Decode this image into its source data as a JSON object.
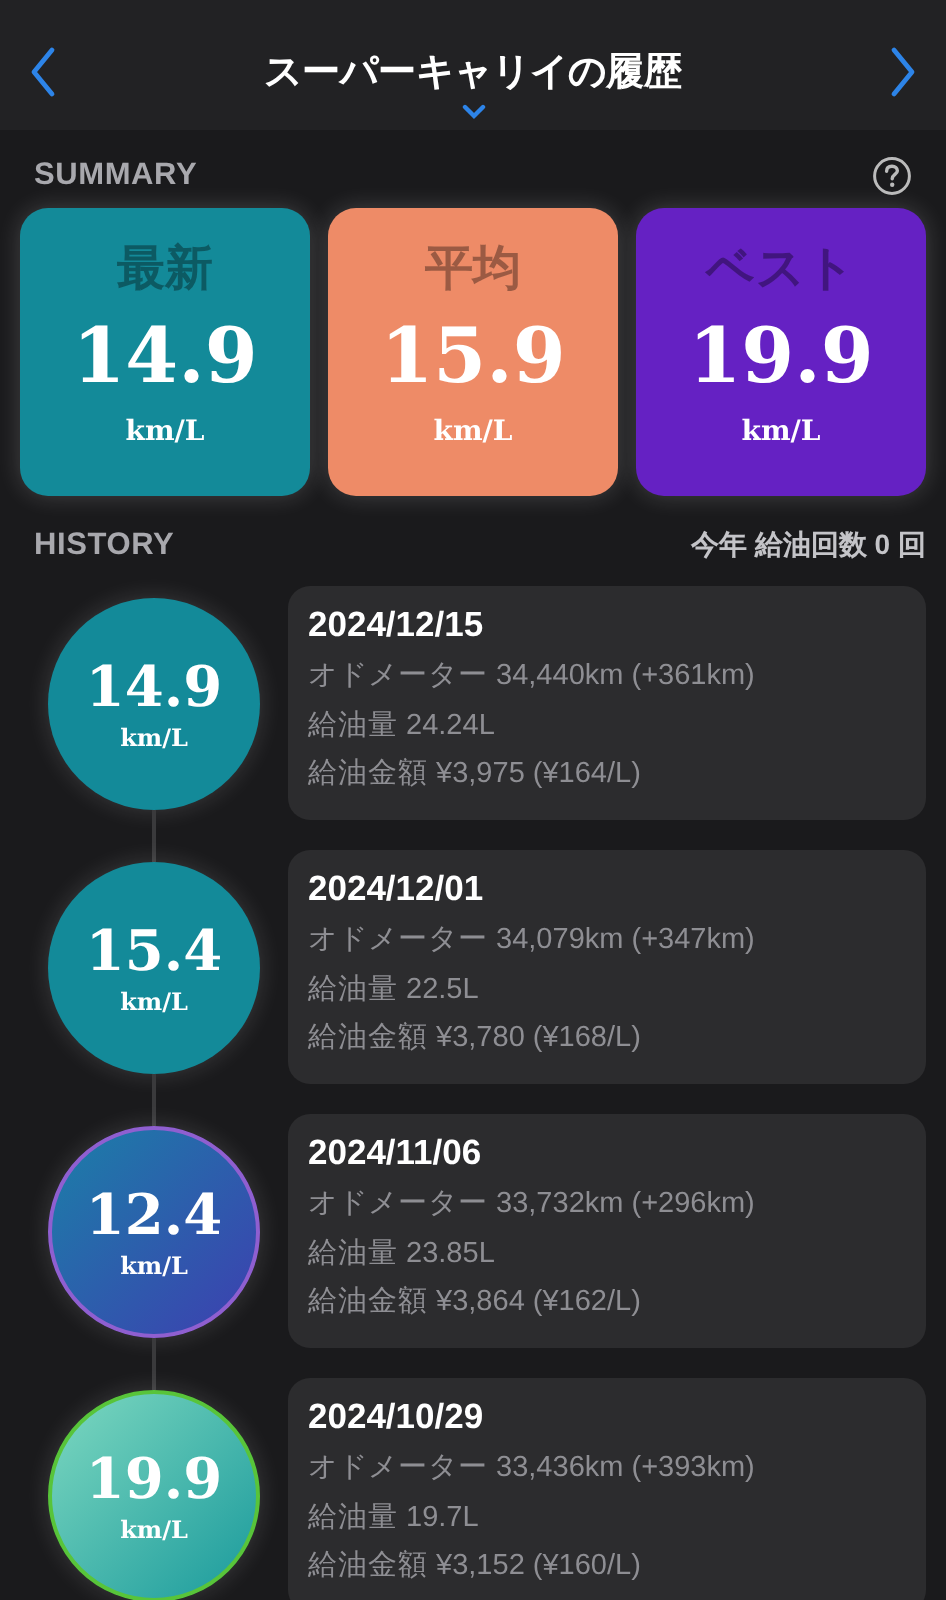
{
  "header": {
    "title": "スーパーキャリイの履歴"
  },
  "summary": {
    "label": "SUMMARY",
    "cards": [
      {
        "label": "最新",
        "value": "14.9",
        "unit": "km/L",
        "color": "#138a99"
      },
      {
        "label": "平均",
        "value": "15.9",
        "unit": "km/L",
        "color": "#ee8b67"
      },
      {
        "label": "ベスト",
        "value": "19.9",
        "unit": "km/L",
        "color": "#6521c3"
      }
    ]
  },
  "history": {
    "label": "HISTORY",
    "count": "今年 給油回数 0 回",
    "entries": [
      {
        "kind": "normal",
        "value": "14.9",
        "unit": "km/L",
        "date": "2024/12/15",
        "odometer": "オドメーター 34,440km (+361km)",
        "amount": "給油量 24.24L",
        "cost": "給油金額 ¥3,975 (¥164/L)"
      },
      {
        "kind": "normal",
        "value": "15.4",
        "unit": "km/L",
        "date": "2024/12/01",
        "odometer": "オドメーター 34,079km (+347km)",
        "amount": "給油量 22.5L",
        "cost": "給油金額 ¥3,780 (¥168/L)"
      },
      {
        "kind": "worst",
        "value": "12.4",
        "unit": "km/L",
        "date": "2024/11/06",
        "odometer": "オドメーター 33,732km (+296km)",
        "amount": "給油量 23.85L",
        "cost": "給油金額 ¥3,864 (¥162/L)"
      },
      {
        "kind": "best",
        "value": "19.9",
        "unit": "km/L",
        "date": "2024/10/29",
        "odometer": "オドメーター 33,436km (+393km)",
        "amount": "給油量 19.7L",
        "cost": "給油金額 ¥3,152 (¥160/L)"
      }
    ]
  }
}
